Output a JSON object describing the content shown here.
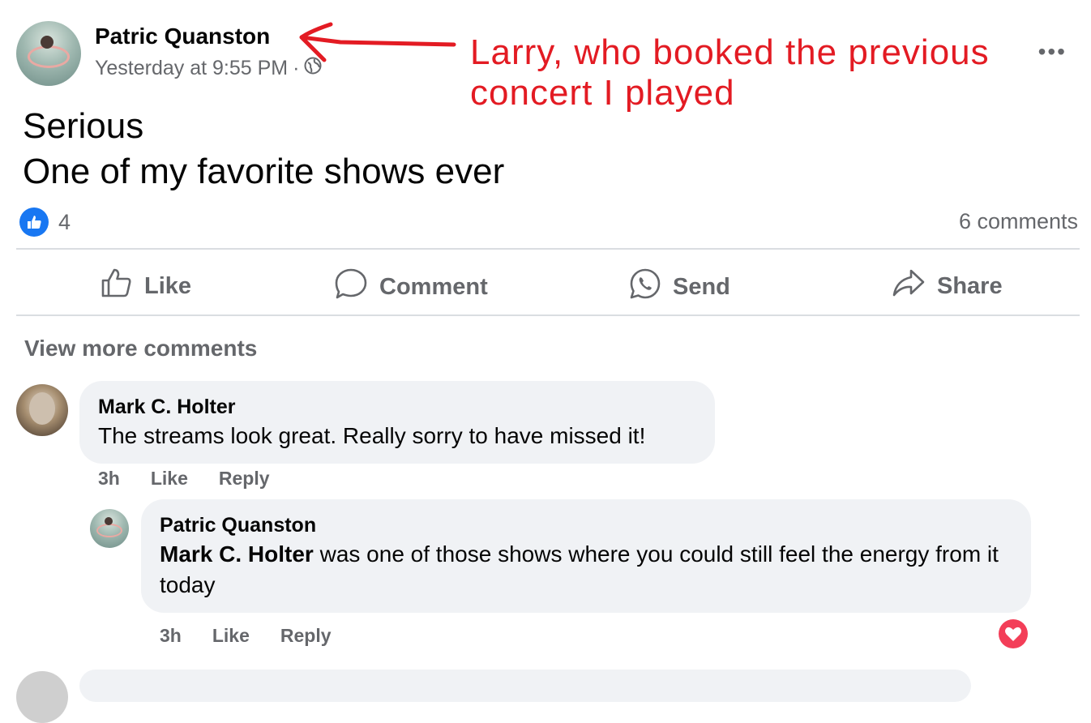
{
  "post": {
    "author": "Patric Quanston",
    "timestamp": "Yesterday at 9:55 PM",
    "separator": "·",
    "privacy_icon": "globe-icon",
    "more_icon": "more-options-icon",
    "more_label": "•••",
    "text_line1": "Serious",
    "text_line2": "One of my favorite shows ever",
    "like_count": "4",
    "comments_count": "6 comments"
  },
  "annotation": {
    "text": "Larry, who booked the previous concert I played",
    "color": "#e31b23"
  },
  "actions": {
    "like": "Like",
    "comment": "Comment",
    "send": "Send",
    "share": "Share"
  },
  "comments_section": {
    "view_more": "View more comments",
    "comments": [
      {
        "author": "Mark C. Holter",
        "text": "The streams look great. Really sorry to have missed it!",
        "time": "3h",
        "like": "Like",
        "reply": "Reply"
      }
    ],
    "reply": {
      "author": "Patric Quanston",
      "mention": "Mark C. Holter",
      "text": " was one of those shows where you could still feel the energy from it today",
      "time": "3h",
      "like": "Like",
      "reply": "Reply",
      "reaction_icon": "heart-reaction-icon"
    }
  },
  "colors": {
    "accent": "#1877f2",
    "secondary_text": "#65676b",
    "bubble_bg": "#f0f2f5",
    "heart": "#f33e58"
  }
}
